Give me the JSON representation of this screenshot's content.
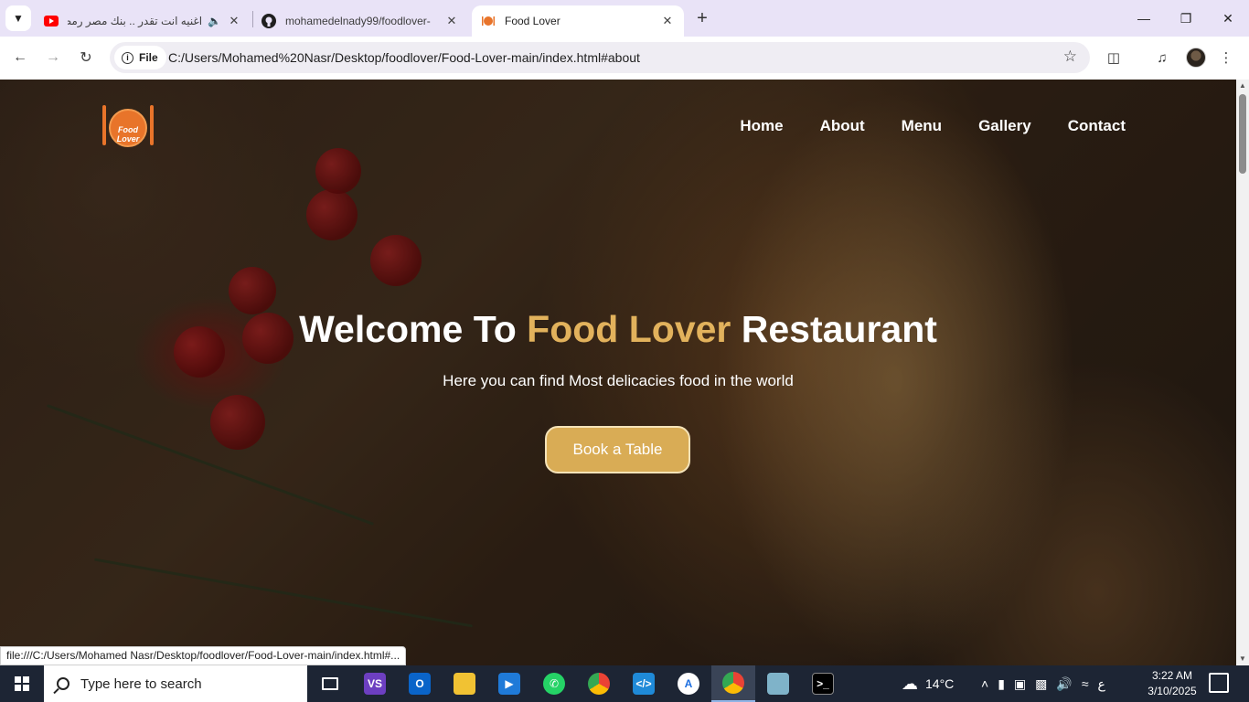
{
  "browser": {
    "tabs": [
      {
        "title": "اغنيه انت تقدر .. بنك مصر رمضان",
        "icon": "youtube-icon",
        "audio": true,
        "active": false
      },
      {
        "title": "mohamedelnady99/foodlover-",
        "icon": "github-icon",
        "active": false
      },
      {
        "title": "Food Lover",
        "icon": "food-lover-favicon",
        "active": true
      }
    ],
    "site_chip": "File",
    "url": "C:/Users/Mohamed%20Nasr/Desktop/foodlover/Food-Lover-main/index.html#about"
  },
  "site": {
    "logo_text": "Food Lover",
    "nav": [
      "Home",
      "About",
      "Menu",
      "Gallery",
      "Contact"
    ],
    "hero": {
      "title_pre": "Welcome To ",
      "title_accent": "Food Lover",
      "title_post": " Restaurant",
      "subtitle": "Here you can find Most delicacies food in the world",
      "button": "Book a Table"
    },
    "accent_color": "#e2b25c",
    "button_color": "#d9ac55",
    "status_link": "file:///C:/Users/Mohamed Nasr/Desktop/foodlover/Food-Lover-main/index.html#..."
  },
  "taskbar": {
    "search_placeholder": "Type here to search",
    "weather": "14°C",
    "time": "3:22 AM",
    "date": "3/10/2025",
    "lang": "ع"
  }
}
